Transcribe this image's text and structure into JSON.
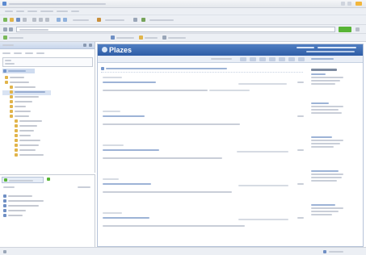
{
  "window": {
    "title": "",
    "brand_color": "#1d4e8f"
  },
  "toolbar": {
    "icons": [
      "new-icon",
      "open-icon",
      "save-icon",
      "print-icon",
      "cut-icon",
      "copy-icon",
      "paste-icon",
      "undo-icon",
      "redo-icon",
      "search-icon",
      "settings-icon"
    ],
    "go_label": "",
    "zoom_label": ""
  },
  "left_pane": {
    "tree_icons": [
      "folder-icon",
      "folder-icon",
      "page-icon",
      "page-icon",
      "page-icon",
      "page-icon",
      "folder-icon",
      "page-icon",
      "page-icon",
      "page-icon",
      "page-icon",
      "page-icon",
      "page-icon",
      "page-icon",
      "page-icon",
      "page-icon",
      "page-icon"
    ],
    "lower_rows": 5
  },
  "main": {
    "logo_text": "Plazes",
    "posts": 5,
    "sidebar_headings": 5
  },
  "colors": {
    "accent": "#2a64b0",
    "status_green": "#58b436",
    "header": "#3d6cb5"
  }
}
